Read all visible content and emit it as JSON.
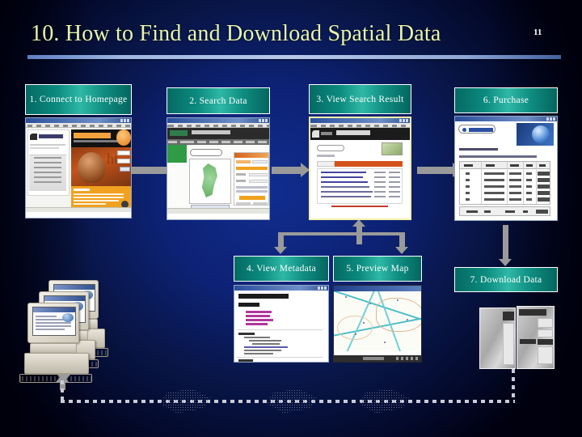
{
  "header": {
    "title": "10. How to Find and Download Spatial Data",
    "page_number": "11"
  },
  "colors": {
    "background_dark": "#000010",
    "background_mid": "#112d8e",
    "title_text": "#e8f5ab",
    "rule": "#b7c9ea",
    "box_teal": "#0c8b7f",
    "box_teal_light": "#2fb8a6",
    "box_border": "#ffffff",
    "arrow_gray": "#9a9a9a",
    "dotted_line": "#c8cdd8",
    "highlight_border": "#f2efa8"
  },
  "steps": [
    {
      "id": "step1",
      "label": "1. Connect to Homepage",
      "screenshot": "homepage-browser-screenshot"
    },
    {
      "id": "step2",
      "label": "2. Search Data",
      "screenshot": "search-data-browser-screenshot"
    },
    {
      "id": "step3",
      "label": "3. View Search Result",
      "screenshot": "search-result-browser-screenshot"
    },
    {
      "id": "step4",
      "label": "4. View Metadata",
      "screenshot": "metadata-document-screenshot"
    },
    {
      "id": "step5",
      "label": "5. Preview Map",
      "screenshot": "map-preview-screenshot"
    },
    {
      "id": "step6",
      "label": "6. Purchase",
      "screenshot": "purchase-table-screenshot"
    },
    {
      "id": "step7",
      "label": "7. Download Data",
      "screenshot": "server-racks-image"
    }
  ],
  "graphics": {
    "client_computers": "desktop-computers-stack",
    "servers": "server-racks",
    "map_sheets": "spatial-data-map-sheets",
    "flow_arrows": "process-flow-arrows",
    "dotted_delivery_path": "data-delivery-dotted-path"
  }
}
